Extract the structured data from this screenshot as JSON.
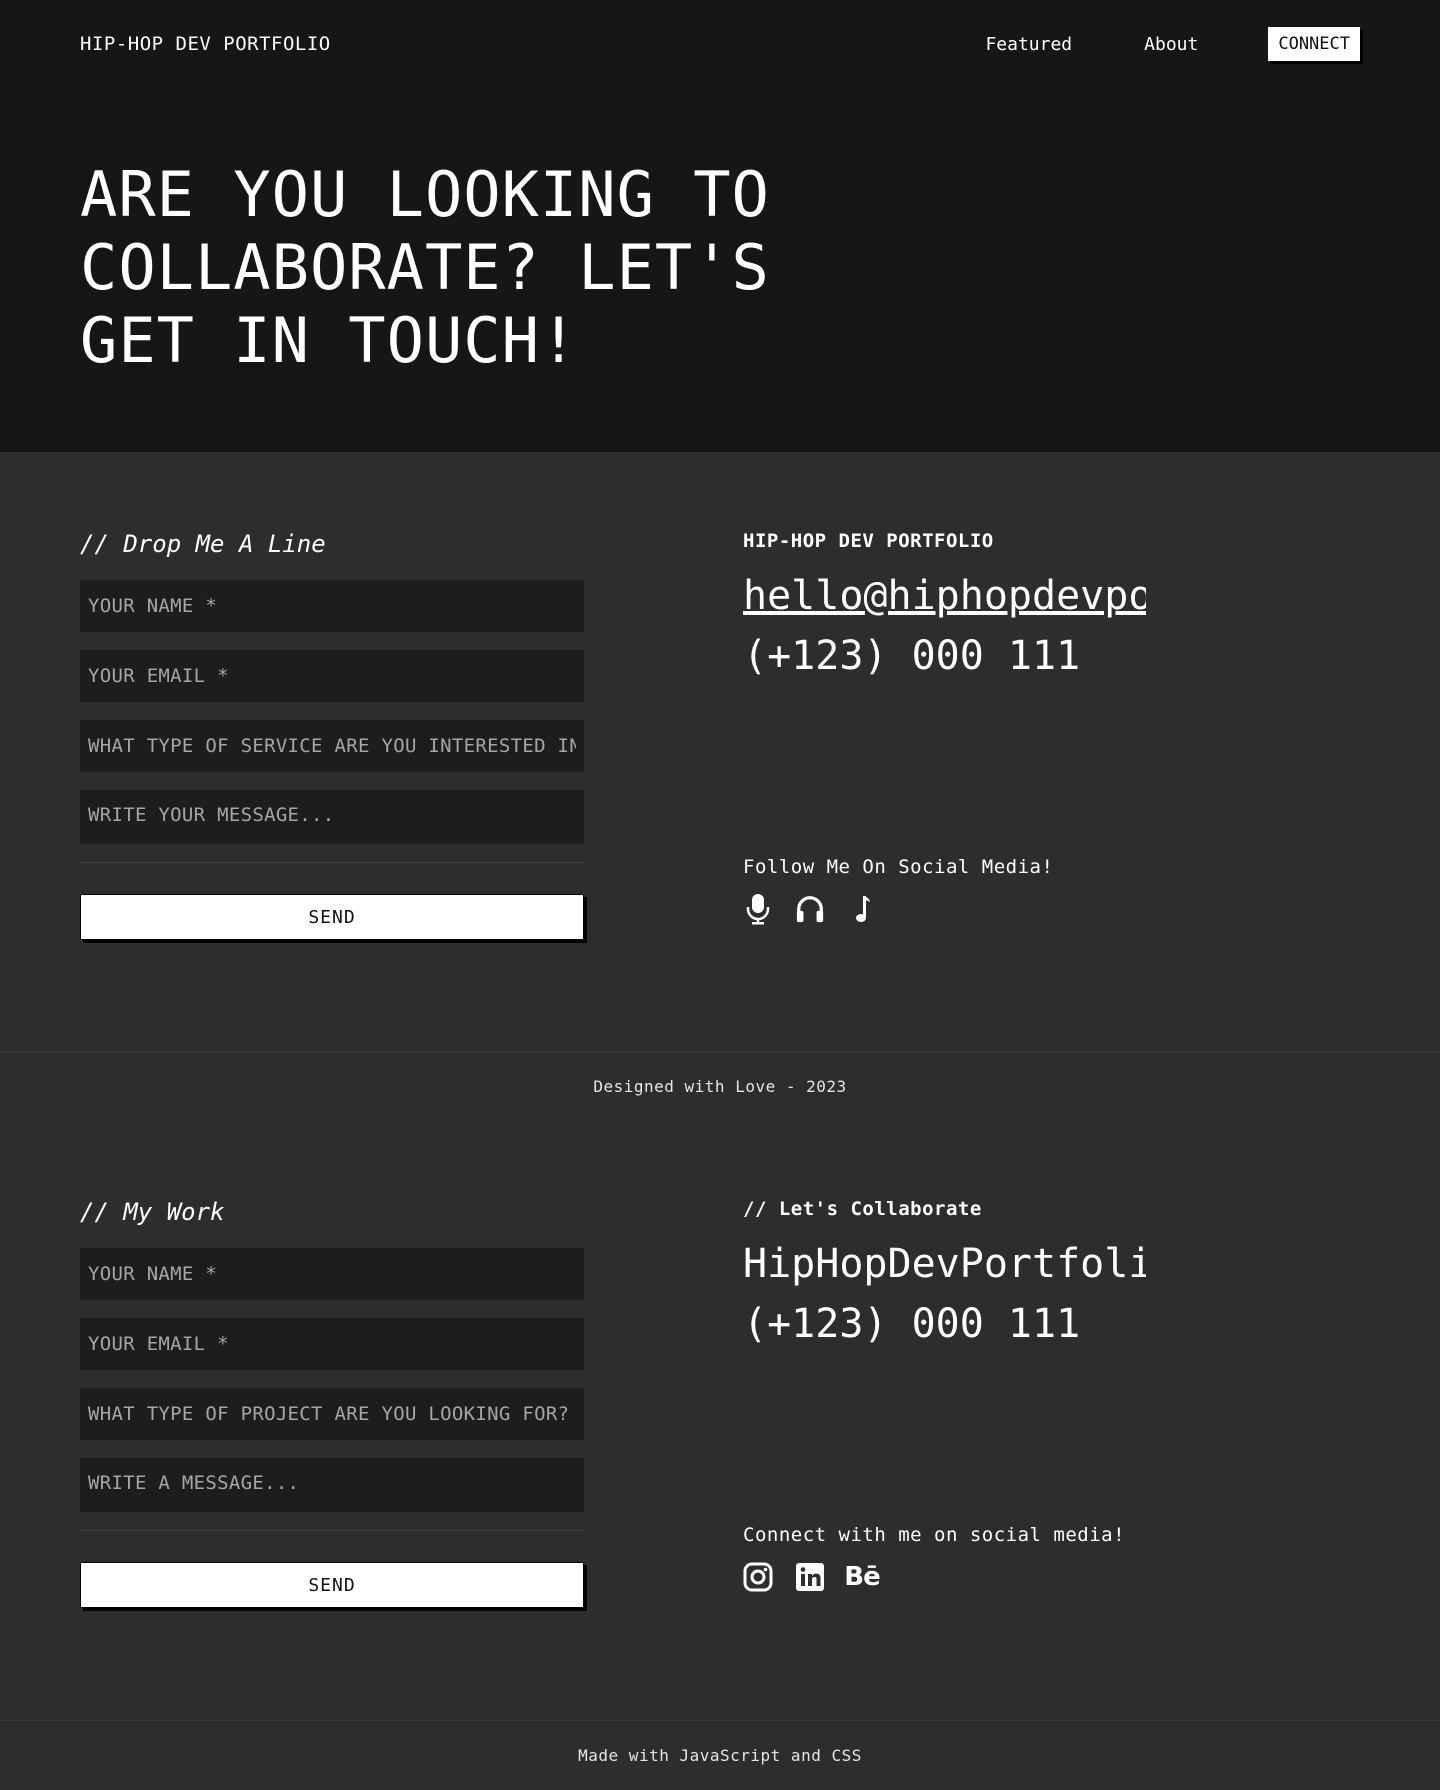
{
  "nav": {
    "brand": "HIP-HOP DEV PORTFOLIO",
    "links": [
      "Featured",
      "About"
    ],
    "cta": "CONNECT"
  },
  "hero": {
    "title": "ARE YOU LOOKING TO COLLABORATE? LET'S GET IN TOUCH!"
  },
  "contact1": {
    "title": "// Drop Me A Line",
    "name_placeholder": "YOUR NAME *",
    "email_placeholder": "YOUR EMAIL *",
    "service_placeholder": "WHAT TYPE OF SERVICE ARE YOU INTERESTED IN?",
    "message_placeholder": "WRITE YOUR MESSAGE...",
    "send_label": "SEND",
    "right_heading": "HIP-HOP DEV PORTFOLIO",
    "email": "hello@hiphopdevportfolio.com",
    "phone": "(+123) 000 111",
    "social_label": "Follow Me On Social Media!",
    "social_icons": [
      "microphone-icon",
      "headphones-icon",
      "music-note-icon"
    ]
  },
  "footer1": {
    "text": "Designed with Love - 2023"
  },
  "contact2": {
    "title": "// My Work",
    "name_placeholder": "YOUR NAME *",
    "email_placeholder": "YOUR EMAIL *",
    "project_placeholder": "WHAT TYPE OF PROJECT ARE YOU LOOKING FOR?",
    "message_placeholder": "WRITE A MESSAGE...",
    "send_label": "SEND",
    "right_heading": "// Let's Collaborate",
    "site": "HipHopDevPortfolio",
    "phone": "(+123) 000 111",
    "social_label": "Connect with me on social media!",
    "social_icons": [
      "instagram-icon",
      "linkedin-icon",
      "behance-icon"
    ],
    "behance_glyph": "Bē"
  },
  "footer2": {
    "text": "Made with JavaScript and CSS"
  }
}
